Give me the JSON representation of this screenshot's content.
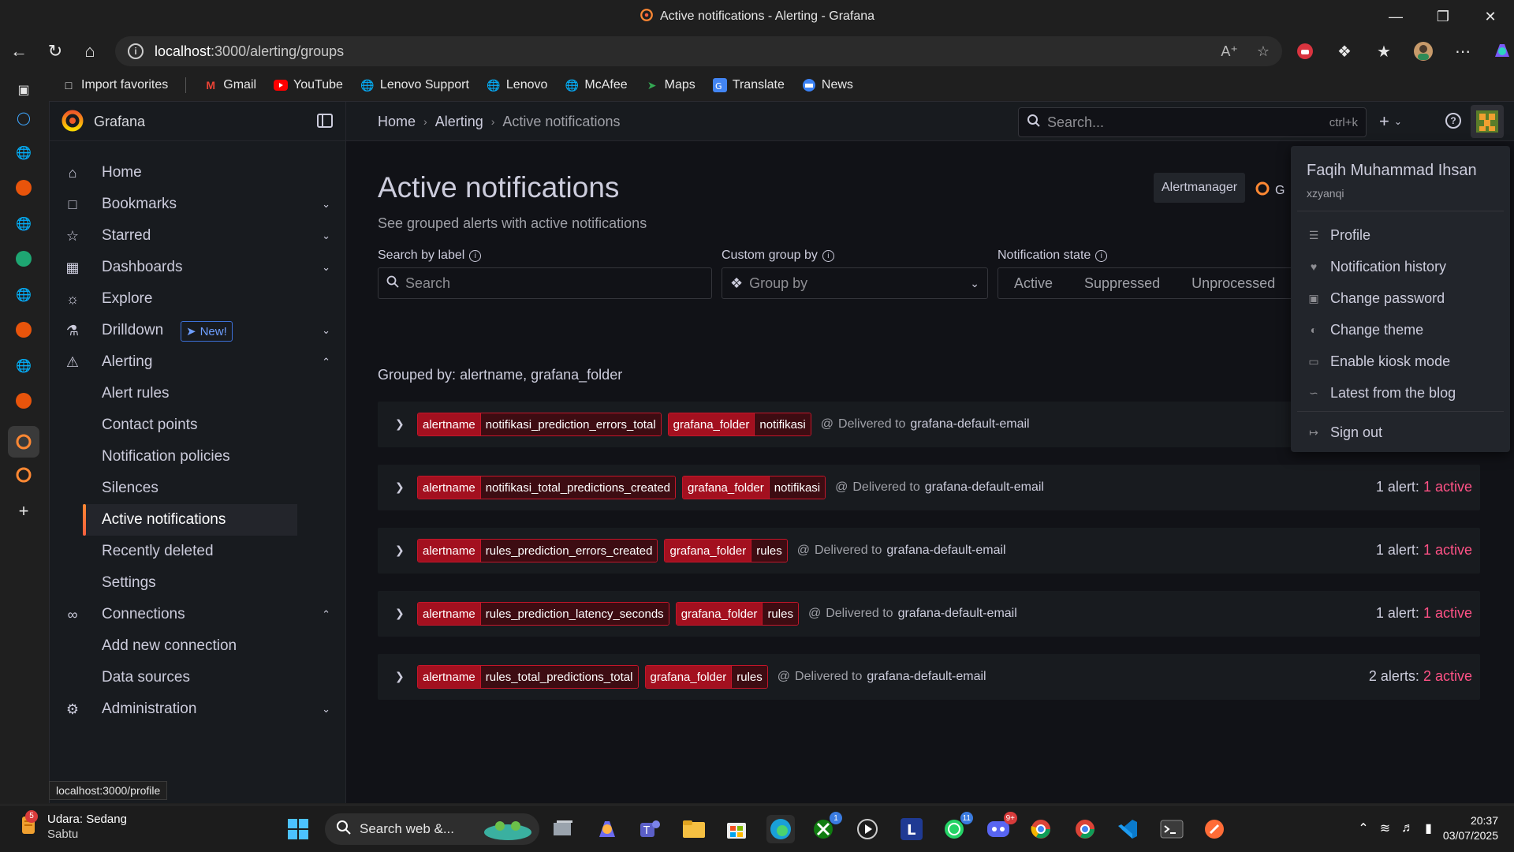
{
  "window": {
    "title": "Active notifications - Alerting - Grafana"
  },
  "browser": {
    "url_host": "localhost",
    "url_path": ":3000/alerting/groups",
    "bookmarks": [
      "Import favorites",
      "Gmail",
      "YouTube",
      "Lenovo Support",
      "Lenovo",
      "McAfee",
      "Maps",
      "Translate",
      "News"
    ],
    "status_url": "localhost:3000/profile"
  },
  "grafana": {
    "brand": "Grafana",
    "breadcrumbs": [
      "Home",
      "Alerting",
      "Active notifications"
    ],
    "search_placeholder": "Search...",
    "search_shortcut": "ctrl+k",
    "nav": {
      "home": "Home",
      "bookmarks": "Bookmarks",
      "starred": "Starred",
      "dashboards": "Dashboards",
      "explore": "Explore",
      "drilldown": "Drilldown",
      "new_badge": "New!",
      "alerting": "Alerting",
      "alert_rules": "Alert rules",
      "contact_points": "Contact points",
      "notification_policies": "Notification policies",
      "silences": "Silences",
      "active_notifications": "Active notifications",
      "recently_deleted": "Recently deleted",
      "settings": "Settings",
      "connections": "Connections",
      "add_new_connection": "Add new connection",
      "data_sources": "Data sources",
      "administration": "Administration"
    },
    "page": {
      "title": "Active notifications",
      "subtitle": "See grouped alerts with active notifications",
      "alertmanager_label": "Alertmanager",
      "alertmanager_value": "G",
      "search_label": "Search by label",
      "search_placeholder": "Search",
      "groupby_label": "Custom group by",
      "groupby_placeholder": "Group by",
      "state_label": "Notification state",
      "states": [
        "Active",
        "Suppressed",
        "Unprocessed"
      ],
      "grouped_by": "Grouped by: alertname, grafana_folder",
      "delivered_prefix": "Delivered to",
      "groups": [
        {
          "alertname": "notifikasi_prediction_errors_total",
          "folder": "notifikasi",
          "receiver": "grafana-default-email",
          "count_text": "",
          "active_text": ""
        },
        {
          "alertname": "notifikasi_total_predictions_created",
          "folder": "notifikasi",
          "receiver": "grafana-default-email",
          "count_text": "1 alert:",
          "active_text": "1 active"
        },
        {
          "alertname": "rules_prediction_errors_created",
          "folder": "rules",
          "receiver": "grafana-default-email",
          "count_text": "1 alert:",
          "active_text": "1 active"
        },
        {
          "alertname": "rules_prediction_latency_seconds",
          "folder": "rules",
          "receiver": "grafana-default-email",
          "count_text": "1 alert:",
          "active_text": "1 active"
        },
        {
          "alertname": "rules_total_predictions_total",
          "folder": "rules",
          "receiver": "grafana-default-email",
          "count_text": "2 alerts:",
          "active_text": "2 active"
        }
      ],
      "label_key_alertname": "alertname",
      "label_key_folder": "grafana_folder"
    },
    "profile_menu": {
      "name": "Faqih Muhammad Ihsan",
      "login": "xzyanqi",
      "items": [
        "Profile",
        "Notification history",
        "Change password",
        "Change theme",
        "Enable kiosk mode",
        "Latest from the blog"
      ],
      "sign_out": "Sign out"
    }
  },
  "taskbar": {
    "weather_title": "Udara: Sedang",
    "weather_day": "Sabtu",
    "weather_badge": "5",
    "search_placeholder": "Search web &...",
    "time": "20:37",
    "date": "03/07/2025",
    "xbox_badge": "1",
    "whatsapp_badge": "11",
    "discord_badge": "9+"
  },
  "colors": {
    "accent": "#ff8833",
    "label_key": "#a3101f",
    "label_value": "#3d0c12",
    "active_count": "#ff5286"
  }
}
